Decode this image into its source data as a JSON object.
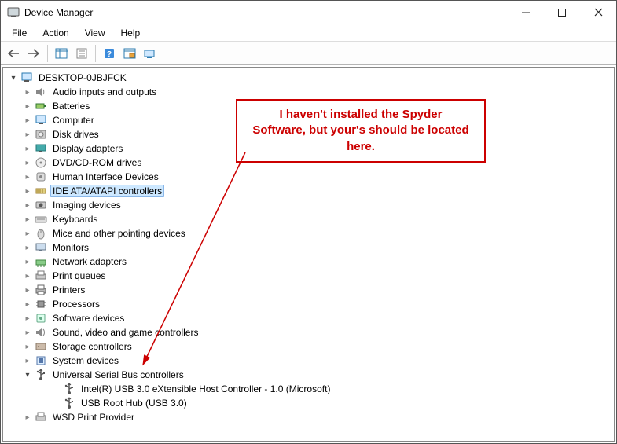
{
  "window": {
    "title": "Device Manager"
  },
  "menubar": {
    "file": "File",
    "action": "Action",
    "view": "View",
    "help": "Help"
  },
  "tree": {
    "root": "DESKTOP-0JBJFCK",
    "items": [
      {
        "label": "Audio inputs and outputs",
        "icon": "speaker",
        "exp": "closed"
      },
      {
        "label": "Batteries",
        "icon": "battery",
        "exp": "closed"
      },
      {
        "label": "Computer",
        "icon": "computer",
        "exp": "closed"
      },
      {
        "label": "Disk drives",
        "icon": "disk",
        "exp": "closed"
      },
      {
        "label": "Display adapters",
        "icon": "display",
        "exp": "closed"
      },
      {
        "label": "DVD/CD-ROM drives",
        "icon": "optical",
        "exp": "closed"
      },
      {
        "label": "Human Interface Devices",
        "icon": "hid",
        "exp": "closed"
      },
      {
        "label": "IDE ATA/ATAPI controllers",
        "icon": "ide",
        "exp": "closed",
        "selected": true
      },
      {
        "label": "Imaging devices",
        "icon": "imaging",
        "exp": "closed"
      },
      {
        "label": "Keyboards",
        "icon": "keyboard",
        "exp": "closed"
      },
      {
        "label": "Mice and other pointing devices",
        "icon": "mouse",
        "exp": "closed"
      },
      {
        "label": "Monitors",
        "icon": "monitor",
        "exp": "closed"
      },
      {
        "label": "Network adapters",
        "icon": "network",
        "exp": "closed"
      },
      {
        "label": "Print queues",
        "icon": "printqueue",
        "exp": "closed"
      },
      {
        "label": "Printers",
        "icon": "printer",
        "exp": "closed"
      },
      {
        "label": "Processors",
        "icon": "cpu",
        "exp": "closed"
      },
      {
        "label": "Software devices",
        "icon": "software",
        "exp": "closed"
      },
      {
        "label": "Sound, video and game controllers",
        "icon": "sound",
        "exp": "closed"
      },
      {
        "label": "Storage controllers",
        "icon": "storage",
        "exp": "closed"
      },
      {
        "label": "System devices",
        "icon": "system",
        "exp": "closed"
      },
      {
        "label": "Universal Serial Bus controllers",
        "icon": "usb",
        "exp": "open",
        "children": [
          {
            "label": "Intel(R) USB 3.0 eXtensible Host Controller - 1.0 (Microsoft)",
            "icon": "usb"
          },
          {
            "label": "USB Root Hub (USB 3.0)",
            "icon": "usb"
          }
        ]
      },
      {
        "label": "WSD Print Provider",
        "icon": "printqueue",
        "exp": "closed"
      }
    ]
  },
  "annotation": {
    "text_line1": "I haven't installed the Spyder",
    "text_line2": "Software, but your's should be located",
    "text_line3": "here."
  }
}
